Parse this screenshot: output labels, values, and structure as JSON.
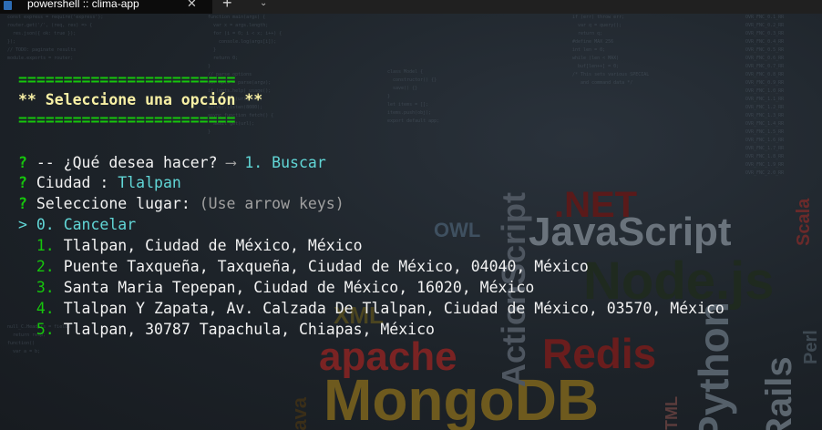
{
  "tab": {
    "icon": "powershell-icon",
    "title": "powershell :: clima-app",
    "close_glyph": "✕",
    "new_tab_glyph": "+",
    "dropdown_glyph": "⌄"
  },
  "colors": {
    "green": "#16c60c",
    "yellow": "#f9f1a5",
    "cyan": "#61d6d6",
    "grey": "#a0a0a0",
    "white": "#f2f2f2"
  },
  "wallpaper": {
    "words": [
      "JavaScript",
      "Node.js",
      "MongoDB",
      "apache",
      "Redis",
      "ActionScript",
      ".NET",
      "OWL",
      "XML",
      "Python",
      "Rails",
      "HTML",
      "Java",
      "Scala",
      "Perl"
    ]
  },
  "menu": {
    "separator": "========================",
    "title": "** Seleccione una opción **"
  },
  "prompts": {
    "q_mark": "?",
    "action": {
      "label": "-- ¿Qué desea hacer?",
      "arrow": "⟶",
      "answer": "1. Buscar"
    },
    "city": {
      "label": "Ciudad :",
      "answer": "Tlalpan"
    },
    "place": {
      "label": "Seleccione lugar:",
      "hint": "(Use arrow keys)"
    }
  },
  "options": {
    "pointer": ">",
    "items": [
      {
        "num": "0.",
        "text": "Cancelar"
      },
      {
        "num": "1.",
        "text": "Tlalpan, Ciudad de México, México"
      },
      {
        "num": "2.",
        "text": "Puente Taxqueña, Taxqueña, Ciudad de México, 04040, México"
      },
      {
        "num": "3.",
        "text": "Santa Maria Tepepan, Ciudad de México, 16020, México"
      },
      {
        "num": "4.",
        "text": "Tlalpan Y Zapata, Av. Calzada De Tlalpan, Ciudad de México, 03570, México"
      },
      {
        "num": "5.",
        "text": "Tlalpan, 30787 Tapachula, Chiapas, México"
      }
    ]
  }
}
